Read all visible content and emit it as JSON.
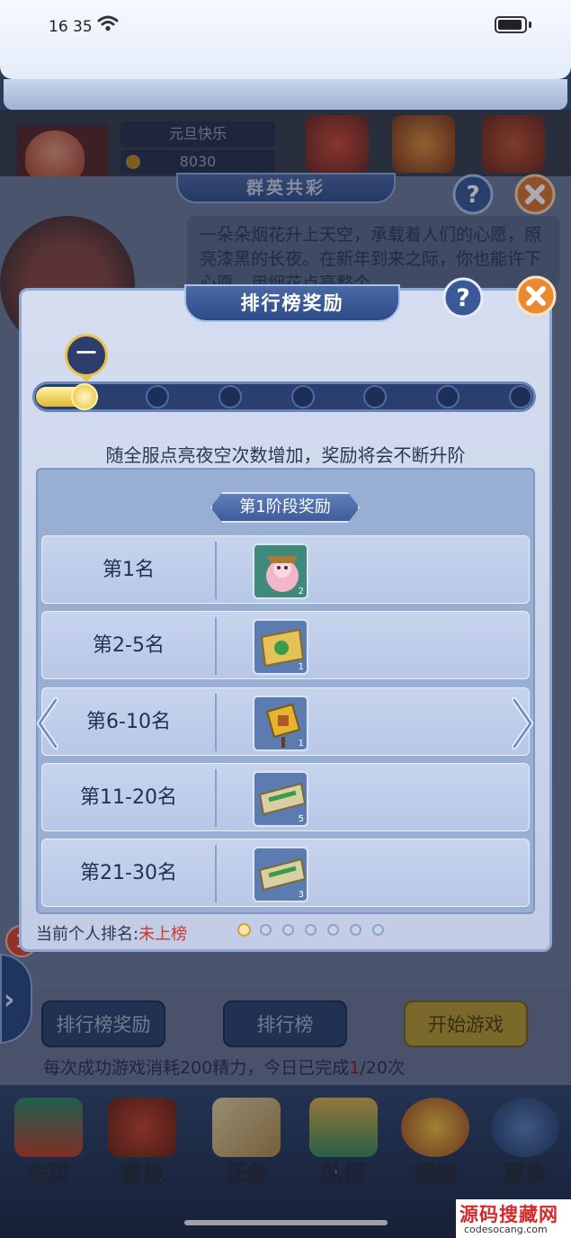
{
  "status_bar": {
    "time": "16 35"
  },
  "background": {
    "player_name": "元旦快乐",
    "coins": "8030",
    "panel_title": "群英共彩",
    "description": "一朵朵烟花升上天空，承载着人们的心愿，照亮漆黑的长夜。在新年到来之际，你也能许下心愿，用烟花点亮整个"
  },
  "dialog": {
    "title": "排行榜奖励",
    "stage_marker": "一",
    "info_text": "随全服点亮夜空次数增加，奖励将会不断升阶",
    "stage_title": "第1阶段奖励",
    "progress": {
      "total_nodes": 7,
      "current_stage": 1
    },
    "rows": [
      {
        "label": "第1名",
        "reward_qty": "2"
      },
      {
        "label": "第2-5名",
        "reward_qty": "1"
      },
      {
        "label": "第6-10名",
        "reward_qty": "1"
      },
      {
        "label": "第11-20名",
        "reward_qty": "5"
      },
      {
        "label": "第21-30名",
        "reward_qty": "3"
      }
    ],
    "rank_status_label": "当前个人排名:",
    "rank_status_value": "未上榜",
    "page_count": 7,
    "current_page": 1
  },
  "bottom": {
    "rank_reward_label": "排行榜奖励",
    "rank_label": "排行榜",
    "start_label": "开始游戏",
    "energy_prefix": "每次成功游戏消耗200精力，今日已完成",
    "energy_done": "1",
    "energy_total": "/20次",
    "notification_count": "1"
  },
  "nav": [
    {
      "label": "主页",
      "icon": "home-icon"
    },
    {
      "label": "背包",
      "icon": "backpack-icon"
    },
    {
      "label": "任务",
      "icon": "quest-icon"
    },
    {
      "label": "队伍",
      "icon": "team-icon"
    },
    {
      "label": "摆摊",
      "icon": "stall-icon"
    },
    {
      "label": "更多",
      "icon": "more-icon"
    }
  ],
  "watermark": {
    "main": "源码搜藏网",
    "sub": "codesocang.com"
  },
  "colors": {
    "accent_gold": "#e5bb35",
    "rank_status_red": "#c93a2e",
    "header_blue": "#2d4b86"
  }
}
